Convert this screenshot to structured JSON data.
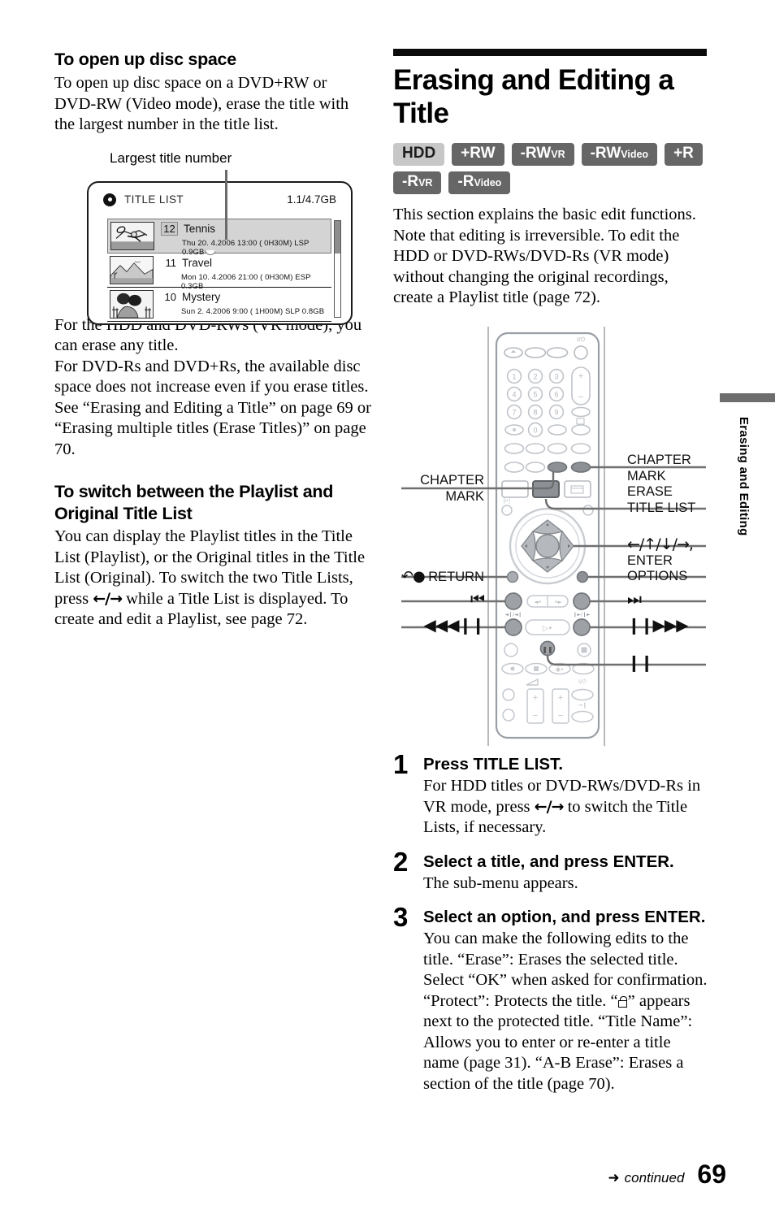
{
  "left": {
    "heading": "To open up disc space",
    "intro": "To open up disc space on a DVD+RW or DVD-RW (Video mode), erase the title with the largest number in the title list.",
    "figure_caption": "Largest title number",
    "screen": {
      "title": "TITLE LIST",
      "capacity": "1.1/4.7GB",
      "rows": [
        {
          "number": "12",
          "name": "Tennis",
          "meta": "Thu  20. 4.2006    13:00 (  0H30M) LSP 0.9GB",
          "selected": true
        },
        {
          "number": "11",
          "name": "Travel",
          "meta": "Mon  10. 4.2006   21:00 (  0H30M) ESP 0.3GB",
          "selected": false
        },
        {
          "number": "10",
          "name": "Mystery",
          "meta": "Sun    2. 4.2006     9:00 (  1H00M) SLP 0.8GB",
          "selected": false
        }
      ]
    },
    "body1_p1": "For the HDD and DVD-RWs (VR mode), you can erase any title.",
    "body1_p2": "For DVD-Rs and DVD+Rs, the available disc space does not increase even if you erase titles.",
    "body1_p3": "See “Erasing and Editing a Title” on page 69 or “Erasing multiple titles (Erase Titles)” on page 70.",
    "heading2": "To switch between the Playlist and Original Title List",
    "body2_a": "You can display the Playlist titles in the Title List (Playlist), or the Original titles in the Title List (Original). To switch the two Title Lists, press",
    "body2_arrows": "←/→",
    "body2_b": "while a Title List is displayed. To create and edit a Playlist, see page 72."
  },
  "right": {
    "title": "Erasing and Editing a Title",
    "badges": [
      {
        "main": "HDD",
        "sub": "",
        "light": true
      },
      {
        "main": "+RW",
        "sub": "",
        "light": false
      },
      {
        "main": "-RW",
        "sub": "VR",
        "light": false
      },
      {
        "main": "-RW",
        "sub": "Video",
        "light": false
      },
      {
        "main": "+R",
        "sub": "",
        "light": false
      },
      {
        "main": "-R",
        "sub": "VR",
        "light": false
      },
      {
        "main": "-R",
        "sub": "Video",
        "light": false
      }
    ],
    "intro": "This section explains the basic edit functions. Note that editing is irreversible. To edit the HDD or DVD-RWs/DVD-Rs (VR mode) without changing the original recordings, create a Playlist title (page 72)."
  },
  "remote": {
    "callouts_left": [
      {
        "id": "chapter-mark",
        "lines": [
          "CHAPTER",
          "MARK"
        ]
      },
      {
        "id": "return",
        "lines": [
          "RETURN"
        ],
        "icon": "return-icon"
      },
      {
        "id": "prev",
        "lines": [
          "⏮"
        ]
      },
      {
        "id": "rewind-slow",
        "lines": [
          "◀◀◀❙❙"
        ]
      }
    ],
    "callouts_right": [
      {
        "id": "chapter-mark-erase",
        "lines": [
          "CHAPTER",
          "MARK",
          "ERASE"
        ]
      },
      {
        "id": "title-list",
        "lines": [
          "TITLE LIST"
        ]
      },
      {
        "id": "direction-enter",
        "lines": [
          "←/↑/↓/→,",
          "ENTER"
        ]
      },
      {
        "id": "options",
        "lines": [
          "OPTIONS"
        ]
      },
      {
        "id": "next",
        "lines": [
          "⏭"
        ]
      },
      {
        "id": "forward-slow",
        "lines": [
          "❙❙▶▶▶"
        ]
      },
      {
        "id": "pause",
        "lines": [
          "❙❙"
        ]
      }
    ],
    "keypad_digits": [
      "1",
      "2",
      "3",
      "4",
      "5",
      "6",
      "7",
      "8",
      "9",
      "0"
    ]
  },
  "steps": [
    {
      "number": "1",
      "title": "Press TITLE LIST.",
      "text_a": "For HDD titles or DVD-RWs/DVD-Rs in VR mode, press",
      "arrows": "←/→",
      "text_b": "to switch the Title Lists, if necessary."
    },
    {
      "number": "2",
      "title": "Select a title, and press ENTER.",
      "text_a": "The sub-menu appears.",
      "arrows": "",
      "text_b": ""
    },
    {
      "number": "3",
      "title": "Select an option, and press ENTER.",
      "text_a": "You can make the following edits to the title.\n“Erase”: Erases the selected title. Select “OK” when asked for confirmation.\n“Protect”: Protects the title. “",
      "arrows": "",
      "text_b": "” appears next to the protected title.\n“Title Name”: Allows you to enter or re-enter a title name (page 31).\n“A-B Erase”: Erases a section of the title (page 70)."
    }
  ],
  "side_tab": {
    "label": "Erasing and Editing"
  },
  "footer": {
    "arrow": "➜",
    "continued": "continued",
    "page": "69"
  },
  "colors": {
    "badge_dark": "#666666",
    "badge_light": "#c7c7c7",
    "rule": "#0a0a0a",
    "tab_gray": "#6d6d6d",
    "leader": "#6a6a6a"
  }
}
